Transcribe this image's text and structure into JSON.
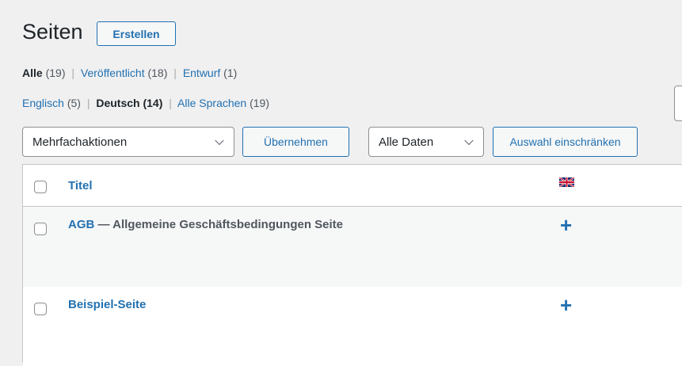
{
  "page": {
    "title": "Seiten",
    "create_label": "Erstellen"
  },
  "status_filters": {
    "all_label": "Alle",
    "all_count": "(19)",
    "published_label": "Veröffentlicht",
    "published_count": "(18)",
    "draft_label": "Entwurf",
    "draft_count": "(1)"
  },
  "language_filters": {
    "english_label": "Englisch",
    "english_count": "(5)",
    "german_label": "Deutsch",
    "german_count": "(14)",
    "all_label": "Alle Sprachen",
    "all_count": "(19)"
  },
  "toolbar": {
    "bulk_actions_value": "Mehrfachaktionen",
    "apply_label": "Übernehmen",
    "date_value": "Alle Daten",
    "filter_label": "Auswahl einschränken"
  },
  "table": {
    "header_title": "Titel",
    "header_flag": "uk-flag-icon",
    "rows": [
      {
        "title": "AGB",
        "state": " — Allgemeine Geschäftsbedingungen Seite",
        "translation_action": "+"
      },
      {
        "title": "Beispiel-Seite",
        "state": "",
        "translation_action": "+"
      }
    ]
  },
  "colors": {
    "accent": "#2271b1",
    "text": "#1d2327",
    "background": "#f0f0f1"
  }
}
